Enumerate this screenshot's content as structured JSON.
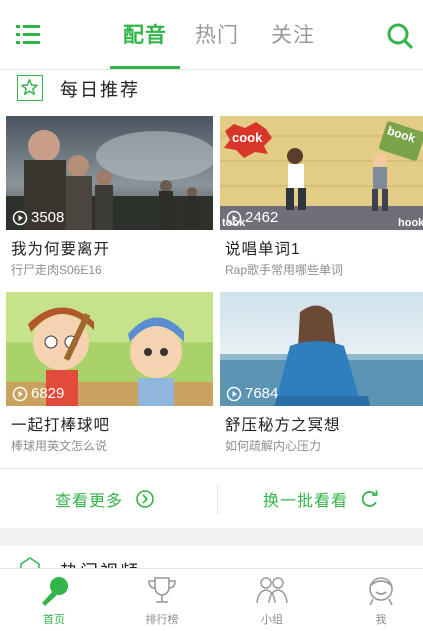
{
  "header": {
    "tabs": [
      {
        "label": "配音",
        "active": true
      },
      {
        "label": "热门",
        "active": false
      },
      {
        "label": "关注",
        "active": false
      }
    ],
    "menu_icon": "menu-list-icon",
    "search_icon": "search-icon"
  },
  "section": {
    "title": "每日推荐",
    "icon": "star-icon"
  },
  "cards": [
    {
      "title": "我为何要离开",
      "subtitle": "行尸走肉S06E16",
      "play_count": "3508",
      "thumb_text": ""
    },
    {
      "title": "说唱单词1",
      "subtitle": "Rap歌手常用哪些单词",
      "play_count": "2462",
      "thumb_text": "cook"
    },
    {
      "title": "一起打棒球吧",
      "subtitle": "棒球用英文怎么说",
      "play_count": "6829",
      "thumb_text": ""
    },
    {
      "title": "舒压秘方之冥想",
      "subtitle": "如何疏解内心压力",
      "play_count": "7684",
      "thumb_text": ""
    }
  ],
  "actions": {
    "more_label": "查看更多",
    "refresh_label": "换一批看看"
  },
  "next_section": {
    "title": "热门视频"
  },
  "bottom_nav": [
    {
      "label": "首页",
      "icon": "microphone-icon",
      "active": true
    },
    {
      "label": "排行榜",
      "icon": "trophy-icon",
      "active": false
    },
    {
      "label": "小组",
      "icon": "group-icon",
      "active": false
    },
    {
      "label": "我",
      "icon": "user-icon",
      "active": false
    }
  ],
  "colors": {
    "accent": "#33b54a",
    "text": "#222222",
    "muted": "#8e8e8e"
  }
}
